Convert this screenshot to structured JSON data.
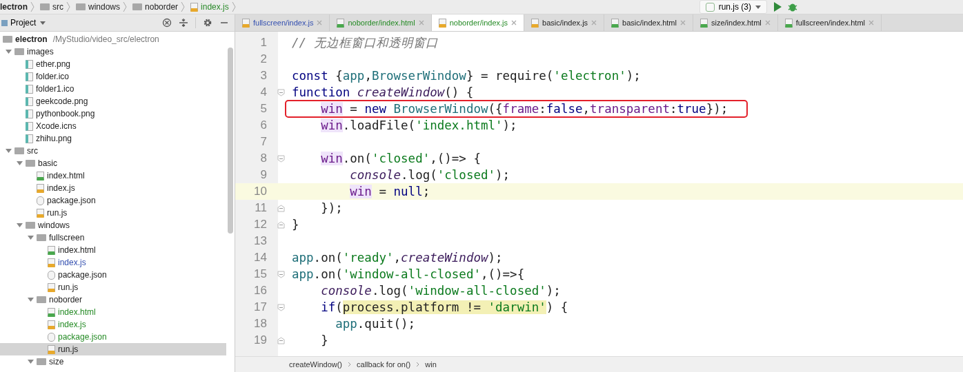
{
  "breadcrumb": [
    {
      "label": "lectron",
      "kind": "root"
    },
    {
      "label": "src",
      "kind": "folder"
    },
    {
      "label": "windows",
      "kind": "folder"
    },
    {
      "label": "noborder",
      "kind": "folder"
    },
    {
      "label": "index.js",
      "kind": "js"
    }
  ],
  "run_config": {
    "label": "run.js (3)"
  },
  "project_panel": {
    "title": "Project",
    "root": {
      "name": "electron",
      "path": "/MyStudio/video_src/electron"
    },
    "tree": [
      {
        "name": "images",
        "kind": "folder",
        "expanded": true,
        "selected": false,
        "children": [
          {
            "name": "ether.png",
            "kind": "image",
            "selected": false
          },
          {
            "name": "folder.ico",
            "kind": "image",
            "selected": false
          },
          {
            "name": "folder1.ico",
            "kind": "image",
            "selected": false
          },
          {
            "name": "geekcode.png",
            "kind": "image",
            "selected": false
          },
          {
            "name": "pythonbook.png",
            "kind": "image",
            "selected": false
          },
          {
            "name": "Xcode.icns",
            "kind": "image",
            "selected": false
          },
          {
            "name": "zhihu.png",
            "kind": "image",
            "selected": false
          }
        ]
      },
      {
        "name": "src",
        "kind": "folder",
        "expanded": true,
        "selected": false,
        "children": [
          {
            "name": "basic",
            "kind": "folder",
            "expanded": true,
            "selected": false,
            "children": [
              {
                "name": "index.html",
                "kind": "html",
                "selected": false
              },
              {
                "name": "index.js",
                "kind": "js",
                "selected": false
              },
              {
                "name": "package.json",
                "kind": "json",
                "selected": false
              },
              {
                "name": "run.js",
                "kind": "js",
                "selected": false
              }
            ]
          },
          {
            "name": "windows",
            "kind": "folder",
            "expanded": true,
            "selected": false,
            "children": [
              {
                "name": "fullscreen",
                "kind": "folder",
                "expanded": true,
                "selected": false,
                "children": [
                  {
                    "name": "index.html",
                    "kind": "html",
                    "selected": false
                  },
                  {
                    "name": "index.js",
                    "kind": "js",
                    "modified": true,
                    "selected": false
                  },
                  {
                    "name": "package.json",
                    "kind": "json",
                    "selected": false
                  },
                  {
                    "name": "run.js",
                    "kind": "js",
                    "selected": false
                  }
                ]
              },
              {
                "name": "noborder",
                "kind": "folder",
                "expanded": true,
                "selected": false,
                "children": [
                  {
                    "name": "index.html",
                    "kind": "html",
                    "added": true,
                    "selected": false
                  },
                  {
                    "name": "index.js",
                    "kind": "js",
                    "added": true,
                    "selected": false
                  },
                  {
                    "name": "package.json",
                    "kind": "json",
                    "added": true,
                    "selected": false
                  },
                  {
                    "name": "run.js",
                    "kind": "js",
                    "selected": true
                  }
                ]
              },
              {
                "name": "size",
                "kind": "folder",
                "expanded": true,
                "selected": false
              }
            ]
          }
        ]
      }
    ]
  },
  "tabs": [
    {
      "label": "fullscreen/index.js",
      "kind": "js",
      "modified": true,
      "selected": false
    },
    {
      "label": "noborder/index.html",
      "kind": "html",
      "added": true,
      "selected": false
    },
    {
      "label": "noborder/index.js",
      "kind": "js",
      "added": true,
      "selected": true
    },
    {
      "label": "basic/index.js",
      "kind": "js",
      "selected": false
    },
    {
      "label": "basic/index.html",
      "kind": "html",
      "selected": false
    },
    {
      "label": "size/index.html",
      "kind": "html",
      "selected": false
    },
    {
      "label": "fullscreen/index.html",
      "kind": "html",
      "selected": false
    }
  ],
  "editor": {
    "lines": [
      {
        "number": "1",
        "current": false,
        "tokens": [
          {
            "t": "// 无边框窗口和透明窗口",
            "kind": "comment"
          }
        ]
      },
      {
        "number": "2",
        "current": false
      },
      {
        "number": "3",
        "current": false,
        "tokens": [
          {
            "t": "const",
            "kind": "kw"
          },
          {
            "t": " {",
            "kind": "plain"
          },
          {
            "t": "app",
            "kind": "ident"
          },
          {
            "t": ",",
            "kind": "plain"
          },
          {
            "t": "BrowserWindow",
            "kind": "ident"
          },
          {
            "t": "} = require(",
            "kind": "plain"
          },
          {
            "t": "'electron'",
            "kind": "str"
          },
          {
            "t": ");",
            "kind": "plain"
          }
        ]
      },
      {
        "number": "4",
        "fold_start": true,
        "current": false,
        "tokens": [
          {
            "t": "function ",
            "kind": "kw"
          },
          {
            "t": "createWindow",
            "kind": "italic"
          },
          {
            "t": "() {",
            "kind": "plain"
          }
        ]
      },
      {
        "number": "5",
        "current": false,
        "boxed": true,
        "tokens": [
          {
            "t": "    win",
            "kind": "var"
          },
          {
            "t": " = ",
            "kind": "plain"
          },
          {
            "t": "new ",
            "kind": "kw"
          },
          {
            "t": "BrowserWindow",
            "kind": "ident"
          },
          {
            "t": "({",
            "kind": "plain"
          },
          {
            "t": "frame",
            "kind": "member"
          },
          {
            "t": ":",
            "kind": "plain"
          },
          {
            "t": "false",
            "kind": "kw"
          },
          {
            "t": ",",
            "kind": "plain"
          },
          {
            "t": "transparent",
            "kind": "member"
          },
          {
            "t": ":",
            "kind": "plain"
          },
          {
            "t": "true",
            "kind": "kw"
          },
          {
            "t": "});",
            "kind": "plain"
          }
        ]
      },
      {
        "number": "6",
        "current": false,
        "tokens": [
          {
            "t": "    win",
            "kind": "var"
          },
          {
            "t": ".loadFile(",
            "kind": "plain"
          },
          {
            "t": "'index.html'",
            "kind": "str"
          },
          {
            "t": ");",
            "kind": "plain"
          }
        ]
      },
      {
        "number": "7",
        "current": false
      },
      {
        "number": "8",
        "fold_start": true,
        "current": false,
        "tokens": [
          {
            "t": "    win",
            "kind": "var"
          },
          {
            "t": ".on(",
            "kind": "plain"
          },
          {
            "t": "'closed'",
            "kind": "str"
          },
          {
            "t": ",()=> {",
            "kind": "plain"
          }
        ]
      },
      {
        "number": "9",
        "current": false,
        "tokens": [
          {
            "t": "        console",
            "kind": "italic"
          },
          {
            "t": ".log(",
            "kind": "plain"
          },
          {
            "t": "'closed'",
            "kind": "str"
          },
          {
            "t": ");",
            "kind": "plain"
          }
        ]
      },
      {
        "number": "10",
        "current": true,
        "tokens": [
          {
            "t": "        win",
            "kind": "var"
          },
          {
            "t": " = ",
            "kind": "plain"
          },
          {
            "t": "null",
            "kind": "kw"
          },
          {
            "t": ";",
            "kind": "plain"
          }
        ]
      },
      {
        "number": "11",
        "fold_end": true,
        "current": false,
        "tokens": [
          {
            "t": "    });",
            "kind": "plain"
          }
        ]
      },
      {
        "number": "12",
        "fold_end": true,
        "current": false,
        "tokens": [
          {
            "t": "}",
            "kind": "plain"
          }
        ]
      },
      {
        "number": "13",
        "current": false
      },
      {
        "number": "14",
        "current": false,
        "tokens": [
          {
            "t": "app",
            "kind": "ident"
          },
          {
            "t": ".on(",
            "kind": "plain"
          },
          {
            "t": "'ready'",
            "kind": "str"
          },
          {
            "t": ",",
            "kind": "plain"
          },
          {
            "t": "createWindow",
            "kind": "italic"
          },
          {
            "t": ");",
            "kind": "plain"
          }
        ]
      },
      {
        "number": "15",
        "fold_start": true,
        "current": false,
        "tokens": [
          {
            "t": "app",
            "kind": "ident"
          },
          {
            "t": ".on(",
            "kind": "plain"
          },
          {
            "t": "'window-all-closed'",
            "kind": "str"
          },
          {
            "t": ",()=>{",
            "kind": "plain"
          }
        ]
      },
      {
        "number": "16",
        "current": false,
        "tokens": [
          {
            "t": "    console",
            "kind": "italic"
          },
          {
            "t": ".log(",
            "kind": "plain"
          },
          {
            "t": "'window-all-closed'",
            "kind": "str"
          },
          {
            "t": ");",
            "kind": "plain"
          }
        ]
      },
      {
        "number": "17",
        "fold_start": true,
        "current": false,
        "tokens": [
          {
            "t": "    if",
            "kind": "kw"
          },
          {
            "t": "(",
            "kind": "plain"
          },
          {
            "t": "process.platform != ",
            "kind": "hl"
          },
          {
            "t": "'darwin'",
            "kind": "hlstr"
          },
          {
            "t": ") {",
            "kind": "plain"
          }
        ]
      },
      {
        "number": "18",
        "current": false,
        "tokens": [
          {
            "t": "      app",
            "kind": "ident"
          },
          {
            "t": ".quit();",
            "kind": "plain"
          }
        ]
      },
      {
        "number": "19",
        "fold_end": true,
        "current": false,
        "tokens": [
          {
            "t": "    }",
            "kind": "plain"
          }
        ]
      }
    ],
    "breadcrumb": [
      "createWindow()",
      "callback for on()",
      "win"
    ]
  }
}
